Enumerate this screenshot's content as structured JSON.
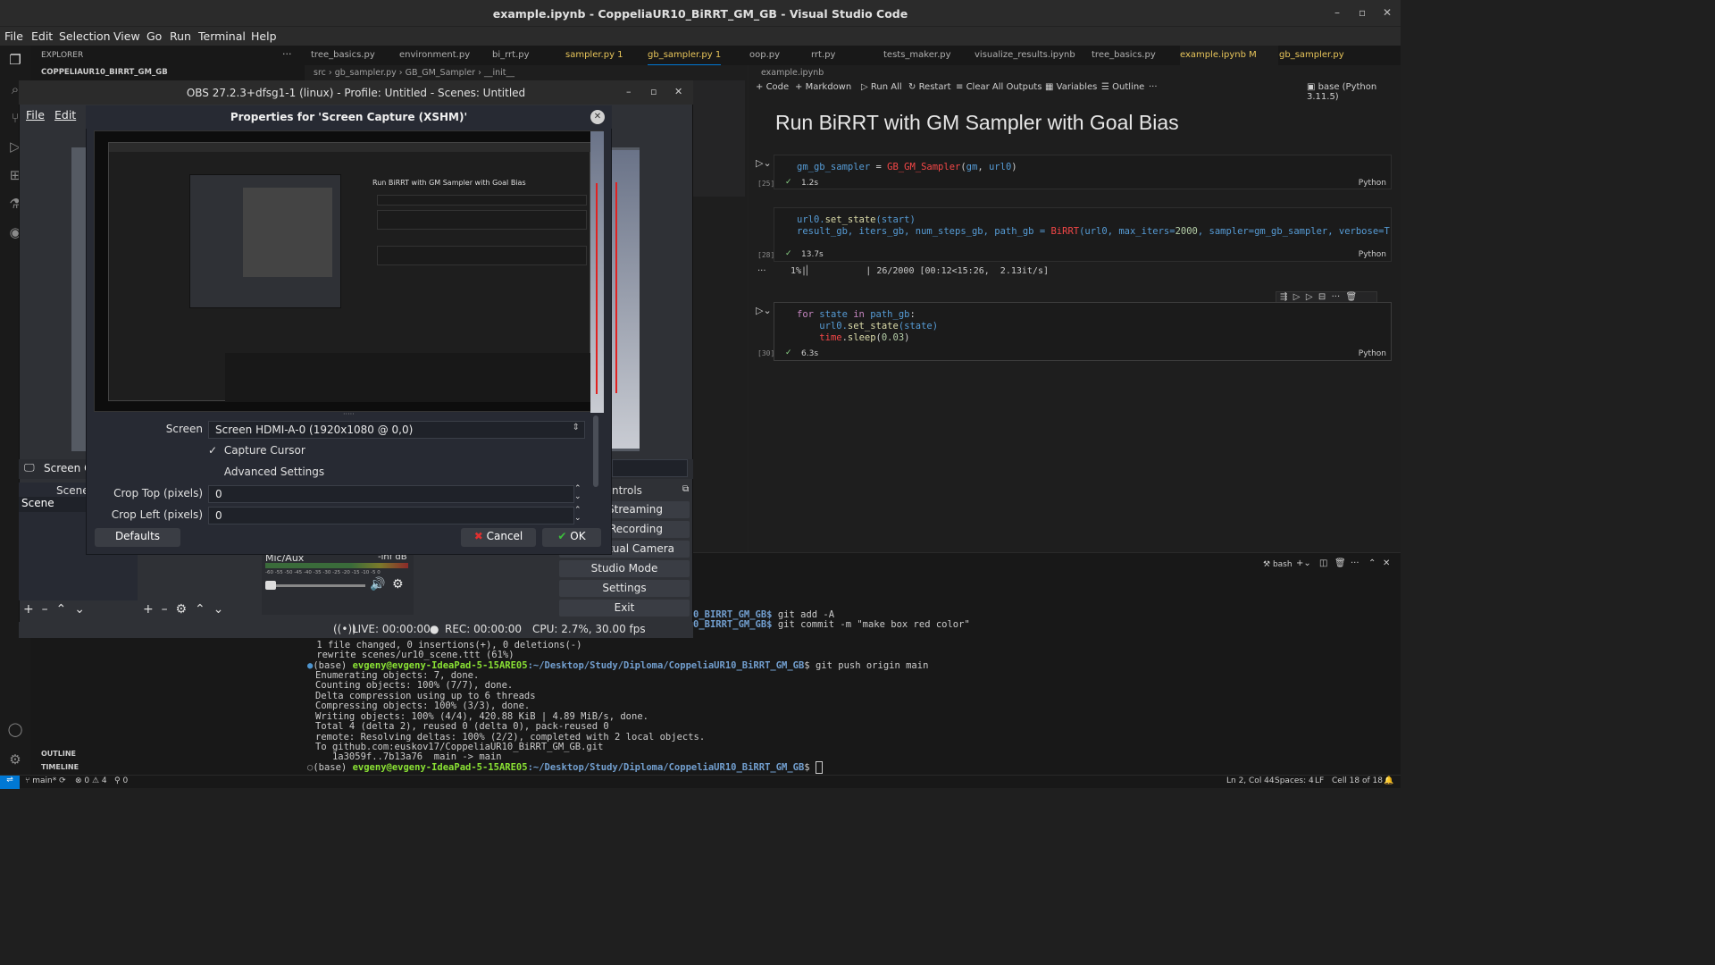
{
  "window": {
    "title": "example.ipynb - CoppeliaUR10_BiRRT_GM_GB - Visual Studio Code"
  },
  "menu": [
    "File",
    "Edit",
    "Selection",
    "View",
    "Go",
    "Run",
    "Terminal",
    "Help"
  ],
  "sidebar": {
    "header": "EXPLORER",
    "project": "COPPELIAUR10_BIRRT_GM_GB",
    "outline": "OUTLINE",
    "timeline": "TIMELINE"
  },
  "left_tabs": [
    "tree_basics.py",
    "environment.py",
    "bi_rrt.py",
    "sampler.py 1",
    "gb_sampler.py 1"
  ],
  "right_tabs": [
    "oop.py",
    "rrt.py",
    "tests_maker.py",
    "visualize_results.ipynb",
    "tree_basics.py",
    "example.ipynb M",
    "gb_sampler.py"
  ],
  "breadcrumb_left": [
    "src",
    "gb_sampler.py",
    "GB_GM_Sampler",
    "__init__"
  ],
  "breadcrumb_right": "example.ipynb",
  "nb_toolbar": [
    "Code",
    "Markdown",
    "Run All",
    "Restart",
    "Clear All Outputs",
    "Variables",
    "Outline"
  ],
  "kernel": "base (Python 3.11.5)",
  "notebook": {
    "heading": "Run BiRRT with GM Sampler with Goal Bias",
    "cells": [
      {
        "exec": "[25]",
        "lines": [
          "gm_gb_sampler = GB_GM_Sampler(gm, url0)"
        ],
        "time": "1.2s",
        "lang": "Python"
      },
      {
        "exec": "[28]",
        "lines": [
          "url0.set_state(start)",
          "result_gb, iters_gb, num_steps_gb, path_gb = BiRRT(url0, max_iters=2000, sampler=gm_gb_sampler, verbose=True, time_l"
        ],
        "time": "13.7s",
        "lang": "Python",
        "output": "1%|▏          | 26/2000 [00:12<15:26,  2.13it/s]"
      },
      {
        "exec": "[30]",
        "lines": [
          "for state in path_gb:",
          "    url0.set_state(state)",
          "    time.sleep(0.03)"
        ],
        "time": "6.3s",
        "lang": "Python"
      }
    ]
  },
  "terminal": {
    "shell": "bash",
    "lines": [
      {
        "prefix": "0_BIRRT_GM_GB$",
        "text": " git add -A"
      },
      {
        "prefix": "0_BIRRT_GM_GB$",
        "text": " git commit -m \"make box red color\""
      },
      {
        "prefix": "",
        "text": " 1 file changed, 0 insertions(+), 0 deletions(-)"
      },
      {
        "prefix": "",
        "text": " rewrite scenes/ur10_scene.ttt (61%)"
      },
      {
        "prefix": "(base) ",
        "user": "evgeny@evgeny-IdeaPad-5-15ARE05",
        "path": ":~/Desktop/Study/Diploma/CoppeliaUR10_BiRRT_GM_GB",
        "text": "$ git push origin main"
      },
      {
        "prefix": "",
        "text": "Enumerating objects: 7, done."
      },
      {
        "prefix": "",
        "text": "Counting objects: 100% (7/7), done."
      },
      {
        "prefix": "",
        "text": "Delta compression using up to 6 threads"
      },
      {
        "prefix": "",
        "text": "Compressing objects: 100% (3/3), done."
      },
      {
        "prefix": "",
        "text": "Writing objects: 100% (4/4), 420.88 KiB | 4.89 MiB/s, done."
      },
      {
        "prefix": "",
        "text": "Total 4 (delta 2), reused 0 (delta 0), pack-reused 0"
      },
      {
        "prefix": "",
        "text": "remote: Resolving deltas: 100% (2/2), completed with 2 local objects."
      },
      {
        "prefix": "",
        "text": "To github.com:euskov17/CoppeliaUR10_BiRRT_GM_GB.git"
      },
      {
        "prefix": "",
        "text": "   1a3059f..7b13a76  main -> main"
      },
      {
        "prefix": "(base) ",
        "user": "evgeny@evgeny-IdeaPad-5-15ARE05",
        "path": ":~/Desktop/Study/Diploma/CoppeliaUR10_BiRRT_GM_GB",
        "text": "$ "
      }
    ]
  },
  "statusbar": {
    "branch": "main*",
    "problems": "⊗ 0 ⚠ 4",
    "ports": "⚲ 0",
    "position": "Ln 2, Col 44",
    "spaces": "Spaces: 4",
    "eol": "LF",
    "cell": "Cell 18 of 18"
  },
  "obs": {
    "title": "OBS 27.2.3+dfsg1-1 (linux) - Profile: Untitled - Scenes: Untitled",
    "menu": [
      "File",
      "Edit"
    ],
    "source": "Screen C",
    "scenes_header": "Scene",
    "scene_item": "Scene",
    "controls_header": "ntrols",
    "buttons": [
      "Streaming",
      "Recording",
      "rtual Camera",
      "Studio Mode",
      "Settings",
      "Exit"
    ],
    "mixer": {
      "name": "Mic/Aux",
      "level": "-inf dB",
      "ticks": "-60 -55 -50 -45 -40 -35 -30 -25 -20 -15 -10 -5 0"
    },
    "status": {
      "live": "LIVE: 00:00:00",
      "rec": "REC: 00:00:00",
      "cpu": "CPU: 2.7%, 30.00 fps"
    }
  },
  "dialog": {
    "title": "Properties for 'Screen Capture (XSHM)'",
    "screen_label": "Screen",
    "screen_value": "Screen HDMI-A-0 (1920x1080 @ 0,0)",
    "capture_cursor": "Capture Cursor",
    "capture_cursor_checked": true,
    "advanced": "Advanced Settings",
    "advanced_checked": false,
    "crop_top_label": "Crop Top (pixels)",
    "crop_top_value": "0",
    "crop_left_label": "Crop Left (pixels)",
    "crop_left_value": "0",
    "defaults": "Defaults",
    "cancel": "Cancel",
    "ok": "OK",
    "preview_heading": "Run BiRRT with GM Sampler with Goal Bias"
  },
  "colors": {
    "accent": "#0078d4",
    "ok_green": "#2e7d32",
    "cancel_red": "#8b1d1d",
    "keyword": "#569cd6",
    "func": "#dcdcaa",
    "red_code": "#f44747"
  }
}
